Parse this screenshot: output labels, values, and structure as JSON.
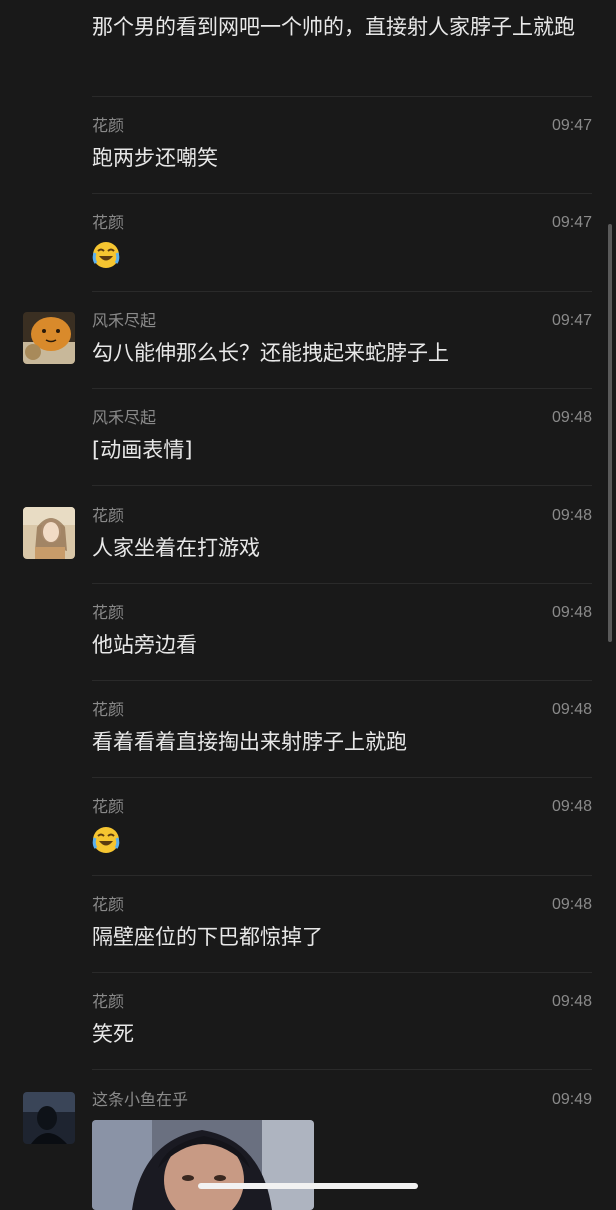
{
  "messages": [
    {
      "text": "那个男的看到网吧一个帅的，直接射人家脖子上就跑"
    },
    {
      "sender": "花颜",
      "time": "09:47",
      "text": "跑两步还嘲笑"
    },
    {
      "sender": "花颜",
      "time": "09:47",
      "emoji": "laughing-crying-emoji"
    },
    {
      "sender": "风禾尽起",
      "time": "09:47",
      "text": "勾八能伸那么长？还能拽起来蛇脖子上"
    },
    {
      "sender": "风禾尽起",
      "time": "09:48",
      "text": "[动画表情]"
    },
    {
      "sender": "花颜",
      "time": "09:48",
      "text": "人家坐着在打游戏"
    },
    {
      "sender": "花颜",
      "time": "09:48",
      "text": "他站旁边看"
    },
    {
      "sender": "花颜",
      "time": "09:48",
      "text": "看着看着直接掏出来射脖子上就跑"
    },
    {
      "sender": "花颜",
      "time": "09:48",
      "emoji": "laughing-crying-emoji"
    },
    {
      "sender": "花颜",
      "time": "09:48",
      "text": "隔壁座位的下巴都惊掉了"
    },
    {
      "sender": "花颜",
      "time": "09:48",
      "text": "笑死"
    },
    {
      "sender": "这条小鱼在乎",
      "time": "09:49",
      "image": "photo-message"
    }
  ],
  "colors": {
    "background": "#191919",
    "text": "#e8e8e8",
    "meta": "#8a8a8a",
    "divider": "#2a2a2a",
    "emoji_yellow": "#f5c531"
  }
}
